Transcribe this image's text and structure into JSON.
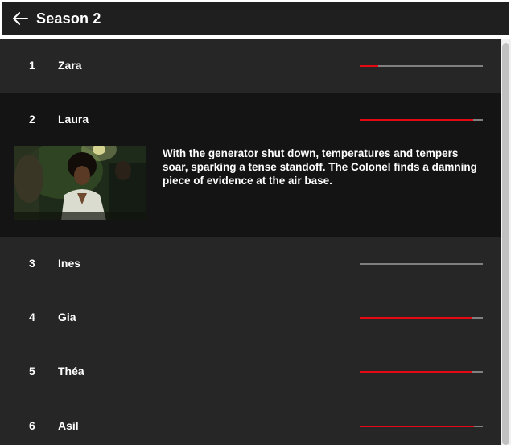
{
  "header": {
    "title": "Season 2"
  },
  "episodes": [
    {
      "number": "1",
      "title": "Zara",
      "progress": 0.15
    },
    {
      "number": "2",
      "title": "Laura",
      "progress": 0.92,
      "synopsis": "With the generator shut down, temperatures and tempers soar, sparking a tense standoff. The Colonel finds a damning piece of evidence at the air base."
    },
    {
      "number": "3",
      "title": "Ines",
      "progress": 0.0
    },
    {
      "number": "4",
      "title": "Gia",
      "progress": 0.91
    },
    {
      "number": "5",
      "title": "Théa",
      "progress": 0.91
    },
    {
      "number": "6",
      "title": "Asil",
      "progress": 0.93
    }
  ],
  "colors": {
    "accent": "#e50914",
    "track": "#808080",
    "row": "#262626",
    "active_row": "#141414"
  },
  "icons": {
    "back": "back-arrow-icon"
  }
}
